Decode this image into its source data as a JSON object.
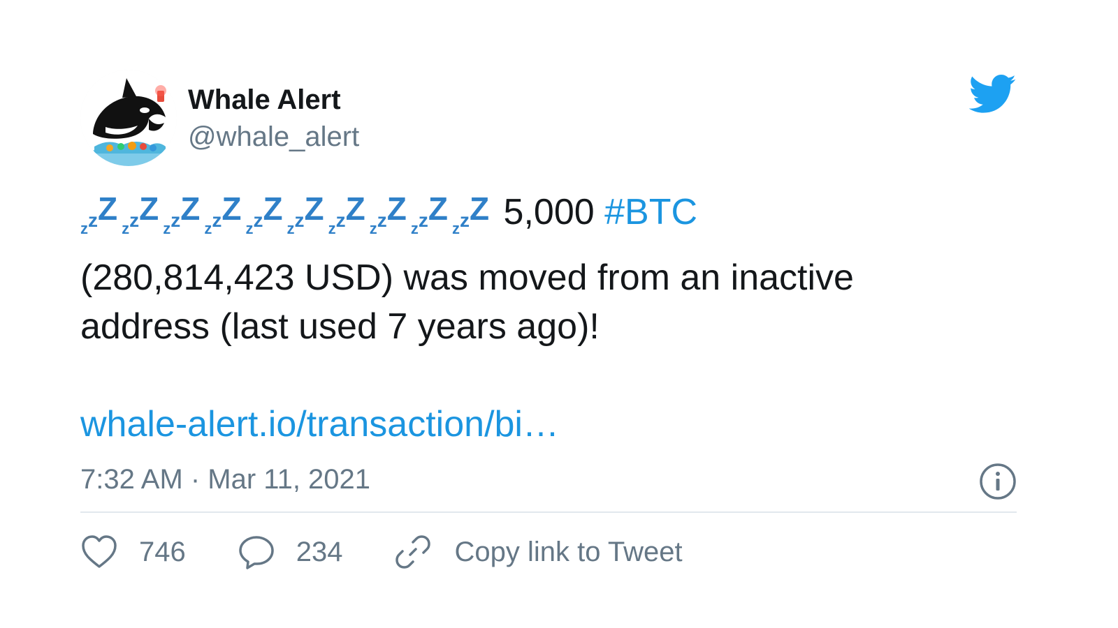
{
  "author": {
    "display_name": "Whale Alert",
    "handle": "@whale_alert"
  },
  "tweet": {
    "zzz_glyph_count": 10,
    "zzz_glyph": "zzZ",
    "amount_text": "5,000",
    "hashtag": "#BTC",
    "line2": "(280,814,423 USD) was moved from an inactive",
    "line3": "address (last used 7 years ago)!",
    "link_text": "whale-alert.io/transaction/bi…",
    "timestamp": "7:32 AM · Mar 11, 2021"
  },
  "actions": {
    "likes": "746",
    "replies": "234",
    "copy_link_label": "Copy link to Tweet"
  },
  "colors": {
    "link": "#1b95e0",
    "twitter_blue": "#1da1f2",
    "muted": "#657786",
    "divider": "#e1e8ed",
    "zzz": "#2f80c8"
  },
  "icons": {
    "logo": "twitter-bird-icon",
    "info": "info-icon",
    "like": "heart-icon",
    "reply": "reply-bubble-icon",
    "copy": "link-icon"
  }
}
